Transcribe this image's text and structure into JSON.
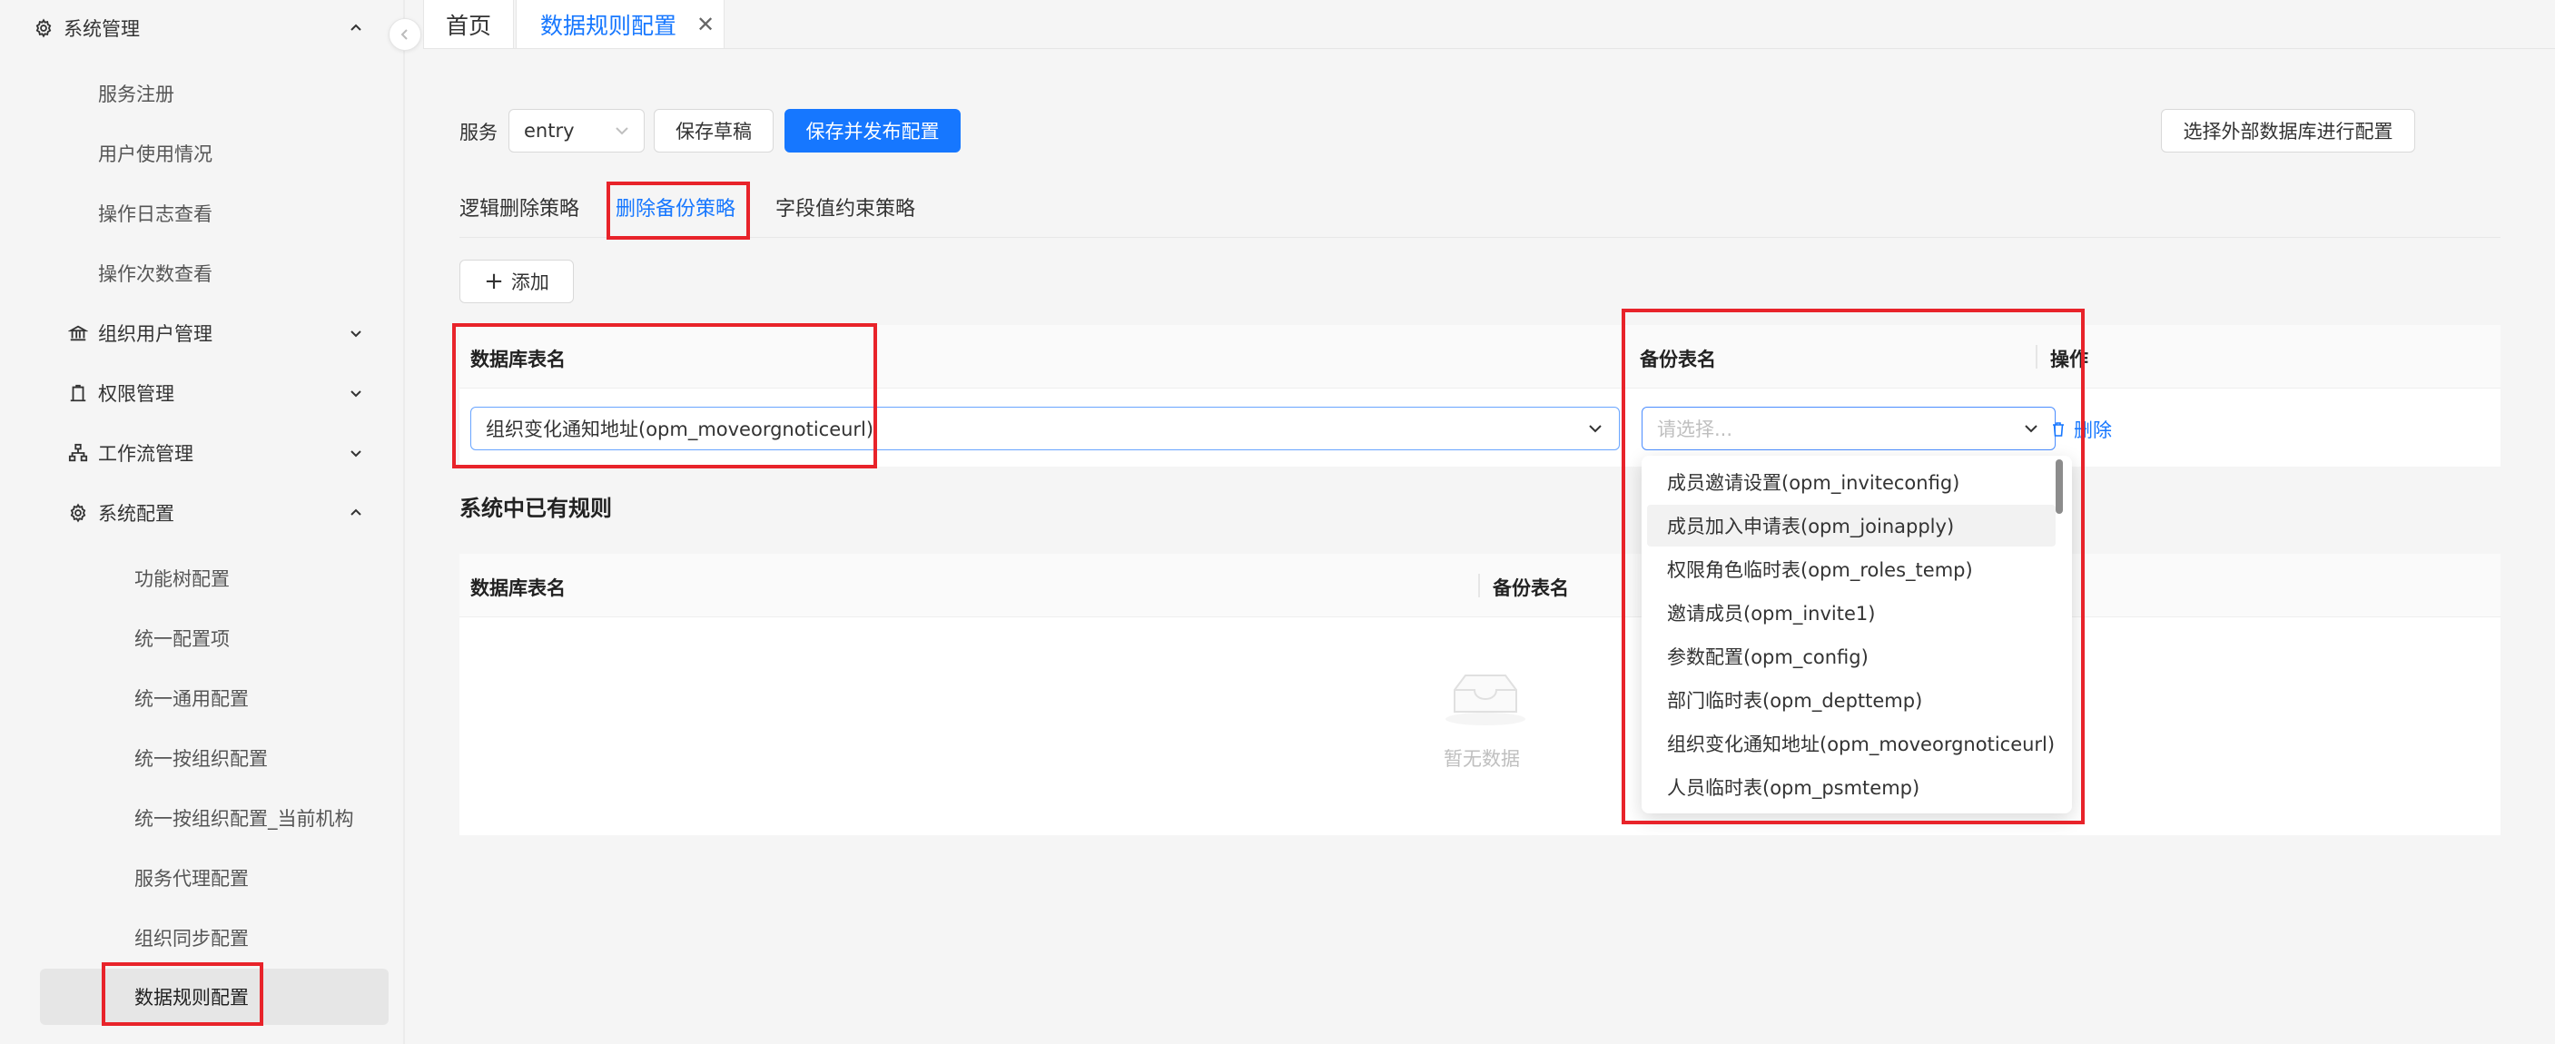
{
  "sidebar": {
    "top_group": "系统管理",
    "top_children": [
      "服务注册",
      "用户使用情况",
      "操作日志查看",
      "操作次数查看"
    ],
    "groups": [
      "组织用户管理",
      "权限管理",
      "工作流管理"
    ],
    "config_group": "系统配置",
    "config_children": [
      "功能树配置",
      "统一配置项",
      "统一通用配置",
      "统一按组织配置",
      "统一按组织配置_当前机构",
      "服务代理配置",
      "组织同步配置",
      "数据规则配置"
    ]
  },
  "tabs": {
    "home": "首页",
    "active": "数据规则配置"
  },
  "toolbar": {
    "service_label": "服务",
    "service_value": "entry",
    "save_draft": "保存草稿",
    "save_publish": "保存并发布配置",
    "external_db": "选择外部数据库进行配置"
  },
  "subtabs": [
    "逻辑删除策略",
    "删除备份策略",
    "字段值约束策略"
  ],
  "add_button": "添加",
  "edit_table": {
    "col_table": "数据库表名",
    "col_backup": "备份表名",
    "col_action": "操作",
    "table_value": "组织变化通知地址(opm_moveorgnoticeurl)",
    "backup_placeholder": "请选择...",
    "delete": "删除"
  },
  "existing": {
    "title": "系统中已有规则",
    "col_table": "数据库表名",
    "col_backup": "备份表名",
    "empty": "暂无数据"
  },
  "dropdown_options": [
    "成员邀请设置(opm_inviteconfig)",
    "成员加入申请表(opm_joinapply)",
    "权限角色临时表(opm_roles_temp)",
    "邀请成员(opm_invite1)",
    "参数配置(opm_config)",
    "部门临时表(opm_depttemp)",
    "组织变化通知地址(opm_moveorgnoticeurl)",
    "人员临时表(opm_psmtemp)"
  ],
  "colors": {
    "accent": "#1677ff",
    "highlight": "#e8232a"
  }
}
